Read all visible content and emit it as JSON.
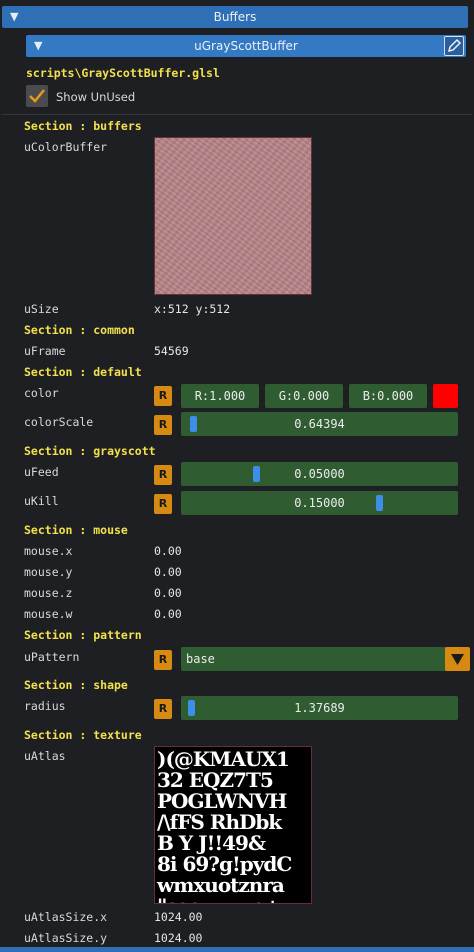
{
  "header": {
    "title": "Buffers"
  },
  "buffer": {
    "title": "uGrayScottBuffer",
    "path": "scripts\\GrayScottBuffer.glsl",
    "show_unused_label": "Show UnUsed"
  },
  "sections": {
    "buffers": "Section : buffers",
    "common": "Section : common",
    "default": "Section : default",
    "grayscott": "Section : grayscott",
    "mouse": "Section : mouse",
    "pattern": "Section : pattern",
    "shape": "Section : shape",
    "texture": "Section : texture"
  },
  "uniforms": {
    "uColorBuffer": "uColorBuffer",
    "uSize": "uSize",
    "uSize_value": "x:512 y:512",
    "uFrame": "uFrame",
    "uFrame_value": "54569",
    "color": "color",
    "color_r": "R:1.000",
    "color_g": "G:0.000",
    "color_b": "B:0.000",
    "color_swatch": "#ff0000",
    "colorScale": "colorScale",
    "colorScale_value": "0.64394",
    "colorScale_fraction": 0.02,
    "uFeed": "uFeed",
    "uFeed_value": "0.05000",
    "uFeed_fraction": 0.26,
    "uKill": "uKill",
    "uKill_value": "0.15000",
    "uKill_fraction": 0.73,
    "mouse_x": "mouse.x",
    "mouse_x_value": "0.00",
    "mouse_y": "mouse.y",
    "mouse_y_value": "0.00",
    "mouse_z": "mouse.z",
    "mouse_z_value": "0.00",
    "mouse_w": "mouse.w",
    "mouse_w_value": "0.00",
    "uPattern": "uPattern",
    "uPattern_value": "base",
    "radius": "radius",
    "radius_value": "1.37689",
    "radius_fraction": 0.01,
    "uAtlas": "uAtlas",
    "uAtlasSize_x": "uAtlasSize.x",
    "uAtlasSize_x_value": "1024.00",
    "uAtlasSize_y": "uAtlasSize.y",
    "uAtlasSize_y_value": "1024.00"
  },
  "reset_label": "R",
  "atlas_lines": [
    ")(@KMAUX1",
    "32 EQZ7T5",
    "POGLWNVH",
    "/\\fFS RhDbk",
    "B Y J!!49&",
    "8i 69?g!pydC",
    "wmxuotznra",
    "\"secu=-=o+:"
  ],
  "icons": {
    "collapse": "triangle-down-icon",
    "edit": "pencil-icon",
    "check": "checkmark-icon",
    "dropdown": "dropdown-arrow-icon"
  }
}
